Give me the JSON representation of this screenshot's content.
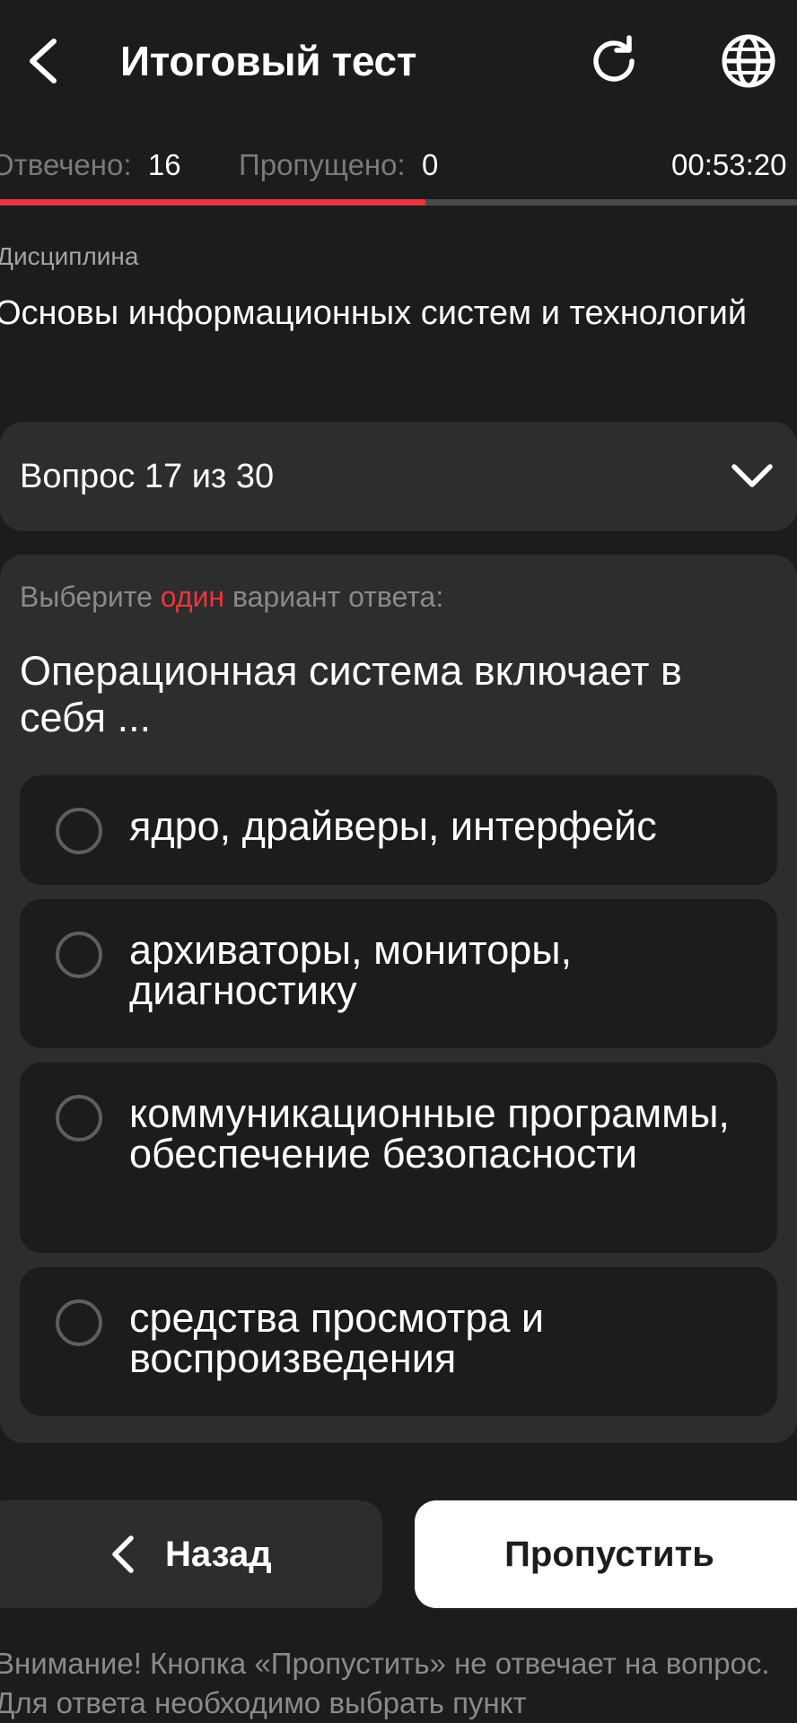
{
  "header": {
    "title": "Итоговый тест",
    "back_icon": "chevron-left-icon",
    "refresh_icon": "refresh-icon",
    "language_icon": "globe-icon"
  },
  "stats": {
    "answered_label": "Отвечено:",
    "answered_value": "16",
    "skipped_label": "Пропущено:",
    "skipped_value": "0",
    "timer": "00:53:20"
  },
  "progress": {
    "fraction": 0.5333
  },
  "discipline": {
    "label": "Дисциплина",
    "name": "Основы информационных систем и технологий"
  },
  "question_selector": {
    "label": "Вопрос 17 из 30",
    "icon": "chevron-down-icon"
  },
  "question": {
    "instruction_prefix": "Выберите ",
    "instruction_highlight": "один",
    "instruction_suffix": " вариант ответа:",
    "text": "Операционная система включает в себя ...",
    "options": [
      {
        "label": "ядро, драйверы, интерфейс",
        "selected": false
      },
      {
        "label": "архиваторы, мониторы, диагностику",
        "selected": false
      },
      {
        "label": "коммуникационные программы, обеспечение безопасности",
        "selected": false
      },
      {
        "label": "средства просмотра и воспроизведения",
        "selected": false
      }
    ]
  },
  "buttons": {
    "back_label": "Назад",
    "skip_label": "Пропустить"
  },
  "warning": "Внимание! Кнопка «Пропустить» не отвечает на вопрос. Для ответа необходимо выбрать пункт",
  "colors": {
    "background": "#1c1c1c",
    "surface": "#2d2d2d",
    "accent": "#e8363f",
    "muted_text": "#8a8a8a"
  }
}
